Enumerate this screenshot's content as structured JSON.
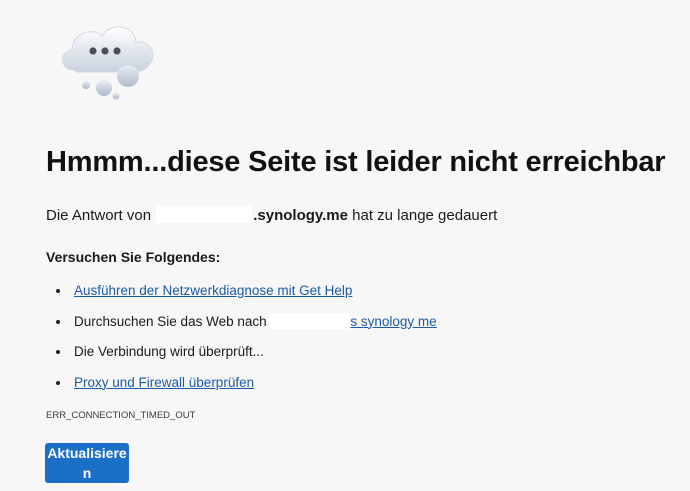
{
  "illustration": {
    "icon": "cloud-thinking-icon"
  },
  "title": "Hmmm...diese Seite ist leider nicht erreichbar",
  "response": {
    "prefix": "Die Antwort von",
    "domain": ".synology.me",
    "suffix": "hat zu lange gedauert"
  },
  "suggestions": {
    "heading": "Versuchen Sie Folgendes:",
    "items": [
      {
        "label": "Ausführen der Netzwerkdiagnose mit Get Help",
        "link": true
      },
      {
        "label": "Durchsuchen Sie das Web nach",
        "link": false,
        "search_link": "s synology me"
      },
      {
        "label": "Die Verbindung wird überprüft...",
        "link": false
      },
      {
        "label": "Proxy und Firewall überprüfen",
        "link": true
      }
    ]
  },
  "error_code": "ERR_CONNECTION_TIMED_OUT",
  "reload_button": {
    "label": "Aktualisieren"
  },
  "colors": {
    "background": "#f7f7f7",
    "link": "#1a5aa6",
    "button": "#1c6fc7"
  }
}
